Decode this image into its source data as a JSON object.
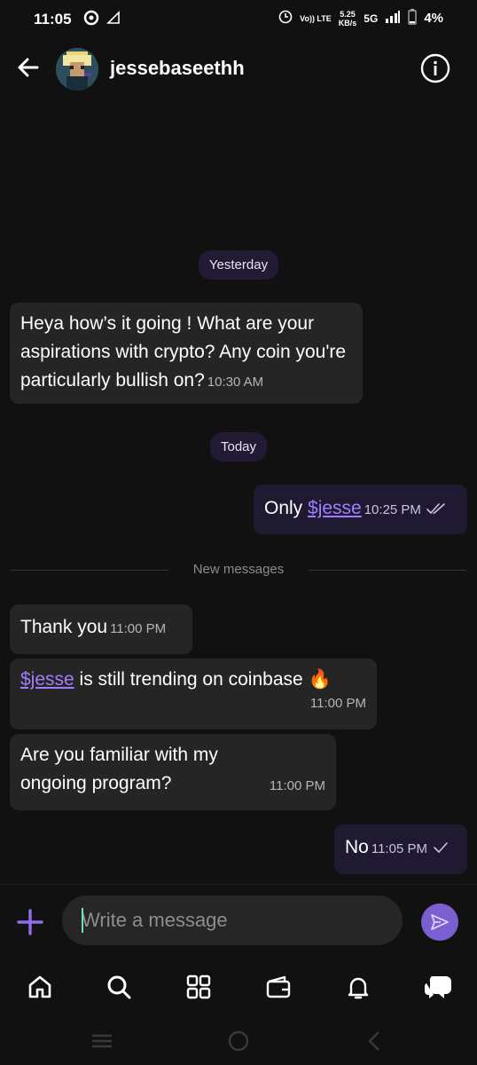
{
  "status_bar": {
    "time": "11:05",
    "network_speed_value": "5.25",
    "network_speed_unit": "KB/s",
    "network_type": "5G",
    "volte_label": "Vo)) LTE",
    "battery": "4%"
  },
  "header": {
    "username": "jessebaseethh"
  },
  "chat": {
    "date_yesterday": "Yesterday",
    "date_today": "Today",
    "new_messages_label": "New messages",
    "messages": [
      {
        "direction": "incoming",
        "text": "Heya how’s it going ! What are your aspirations with crypto? Any coin you're particularly bullish on?",
        "time": "10:30 AM"
      },
      {
        "direction": "outgoing",
        "text_prefix": "Only ",
        "tag": "$jesse",
        "time": "10:25 PM",
        "status": "read"
      },
      {
        "direction": "incoming",
        "text": "Thank you",
        "time": "11:00 PM"
      },
      {
        "direction": "incoming",
        "tag": "$jesse",
        "text_suffix": " is still trending on coinbase 🔥",
        "time": "11:00 PM"
      },
      {
        "direction": "incoming",
        "text": "Are you familiar with my ongoing program?",
        "time": "11:00 PM"
      },
      {
        "direction": "outgoing",
        "text": "No",
        "time": "11:05 PM",
        "status": "sent"
      }
    ]
  },
  "composer": {
    "placeholder": "Write a message"
  },
  "bottom_nav": [
    "home-icon",
    "search-icon",
    "apps-grid-icon",
    "wallet-icon",
    "bell-icon",
    "chat-bubbles-icon"
  ],
  "colors": {
    "background": "#111111",
    "incoming_bubble": "#252525",
    "outgoing_bubble": "#1f1932",
    "accent": "#7b5fd1",
    "link": "#a07dff"
  }
}
